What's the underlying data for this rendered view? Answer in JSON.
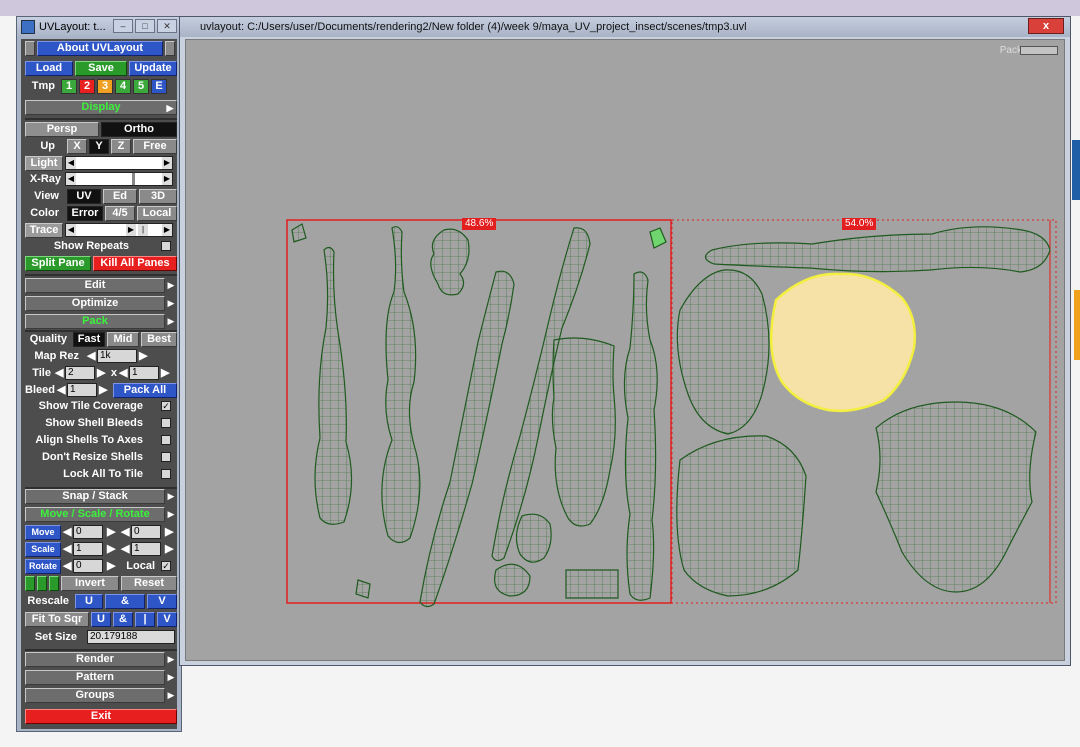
{
  "panel": {
    "title": "UVLayout: t...",
    "about": "About UVLayout",
    "load": "Load",
    "save": "Save",
    "update": "Update",
    "tmp_label": "Tmp",
    "tmp_buttons": [
      {
        "label": "1",
        "color": "#3aa83a"
      },
      {
        "label": "2",
        "color": "#e82020"
      },
      {
        "label": "3",
        "color": "#f0a020"
      },
      {
        "label": "4",
        "color": "#3aa83a"
      },
      {
        "label": "5",
        "color": "#3aa83a"
      },
      {
        "label": "E",
        "color": "#2f56c6"
      }
    ],
    "display": "Display",
    "persp": "Persp",
    "ortho": "Ortho",
    "up_label": "Up",
    "up_options": [
      "X",
      "Y",
      "Z",
      "Free"
    ],
    "light": "Light",
    "xray": "X-Ray",
    "view_label": "View",
    "view_options": [
      "UV",
      "Ed",
      "3D"
    ],
    "color_label": "Color",
    "color_options": [
      "Error",
      "4/5",
      "Local"
    ],
    "trace": "Trace",
    "show_repeats": "Show Repeats",
    "split_pane": "Split Pane",
    "kill_all_panes": "Kill All Panes",
    "edit": "Edit",
    "optimize": "Optimize",
    "pack": "Pack",
    "quality_label": "Quality",
    "quality_options": [
      "Fast",
      "Mid",
      "Best"
    ],
    "map_rez_label": "Map Rez",
    "map_rez_value": "1k",
    "tile_label": "Tile",
    "tile_x": "2",
    "tile_sep": "x",
    "tile_y": "1",
    "bleed_label": "Bleed",
    "bleed_value": "1",
    "pack_all": "Pack All",
    "options": [
      {
        "label": "Show Tile Coverage",
        "checked": "✓"
      },
      {
        "label": "Show Shell Bleeds",
        "checked": ""
      },
      {
        "label": "Align Shells To Axes",
        "checked": ""
      },
      {
        "label": "Don't Resize Shells",
        "checked": ""
      },
      {
        "label": "Lock All To Tile",
        "checked": ""
      }
    ],
    "snap_stack": "Snap / Stack",
    "move_scale_rotate": "Move / Scale / Rotate",
    "move": "Move",
    "move_a": "0",
    "move_b": "0",
    "scale": "Scale",
    "scale_a": "1",
    "scale_b": "1",
    "rotate": "Rotate",
    "rotate_a": "0",
    "local": "Local",
    "invert": "Invert",
    "reset": "Reset",
    "rescale_label": "Rescale",
    "rescale_u": "U",
    "rescale_amp": "&",
    "rescale_v": "V",
    "fit_to_sqr": "Fit To Sqr",
    "fit_u": "U",
    "fit_amp": "&",
    "fit_bar": "|",
    "fit_v": "V",
    "set_size_label": "Set Size",
    "set_size_value": "20.179188",
    "render": "Render",
    "pattern": "Pattern",
    "groups": "Groups",
    "exit": "Exit"
  },
  "main": {
    "title": "uvlayout: C:/Users/user/Documents/rendering2/New folder (4)/week 9/maya_UV_project_insect/scenes/tmp3.uvl",
    "close": "x",
    "pack_label": "Pack",
    "tile1_pct": "48.6%",
    "tile2_pct": "54.0%"
  },
  "colors": {
    "panel_bg": "#4d4d4d",
    "viewport_bg": "#a3a3a3",
    "shell_fill": "#d8edd4",
    "shell_line": "#1f5a1f",
    "tile_border": "#e21e1e",
    "selected_shell": "#f3ef3f"
  }
}
